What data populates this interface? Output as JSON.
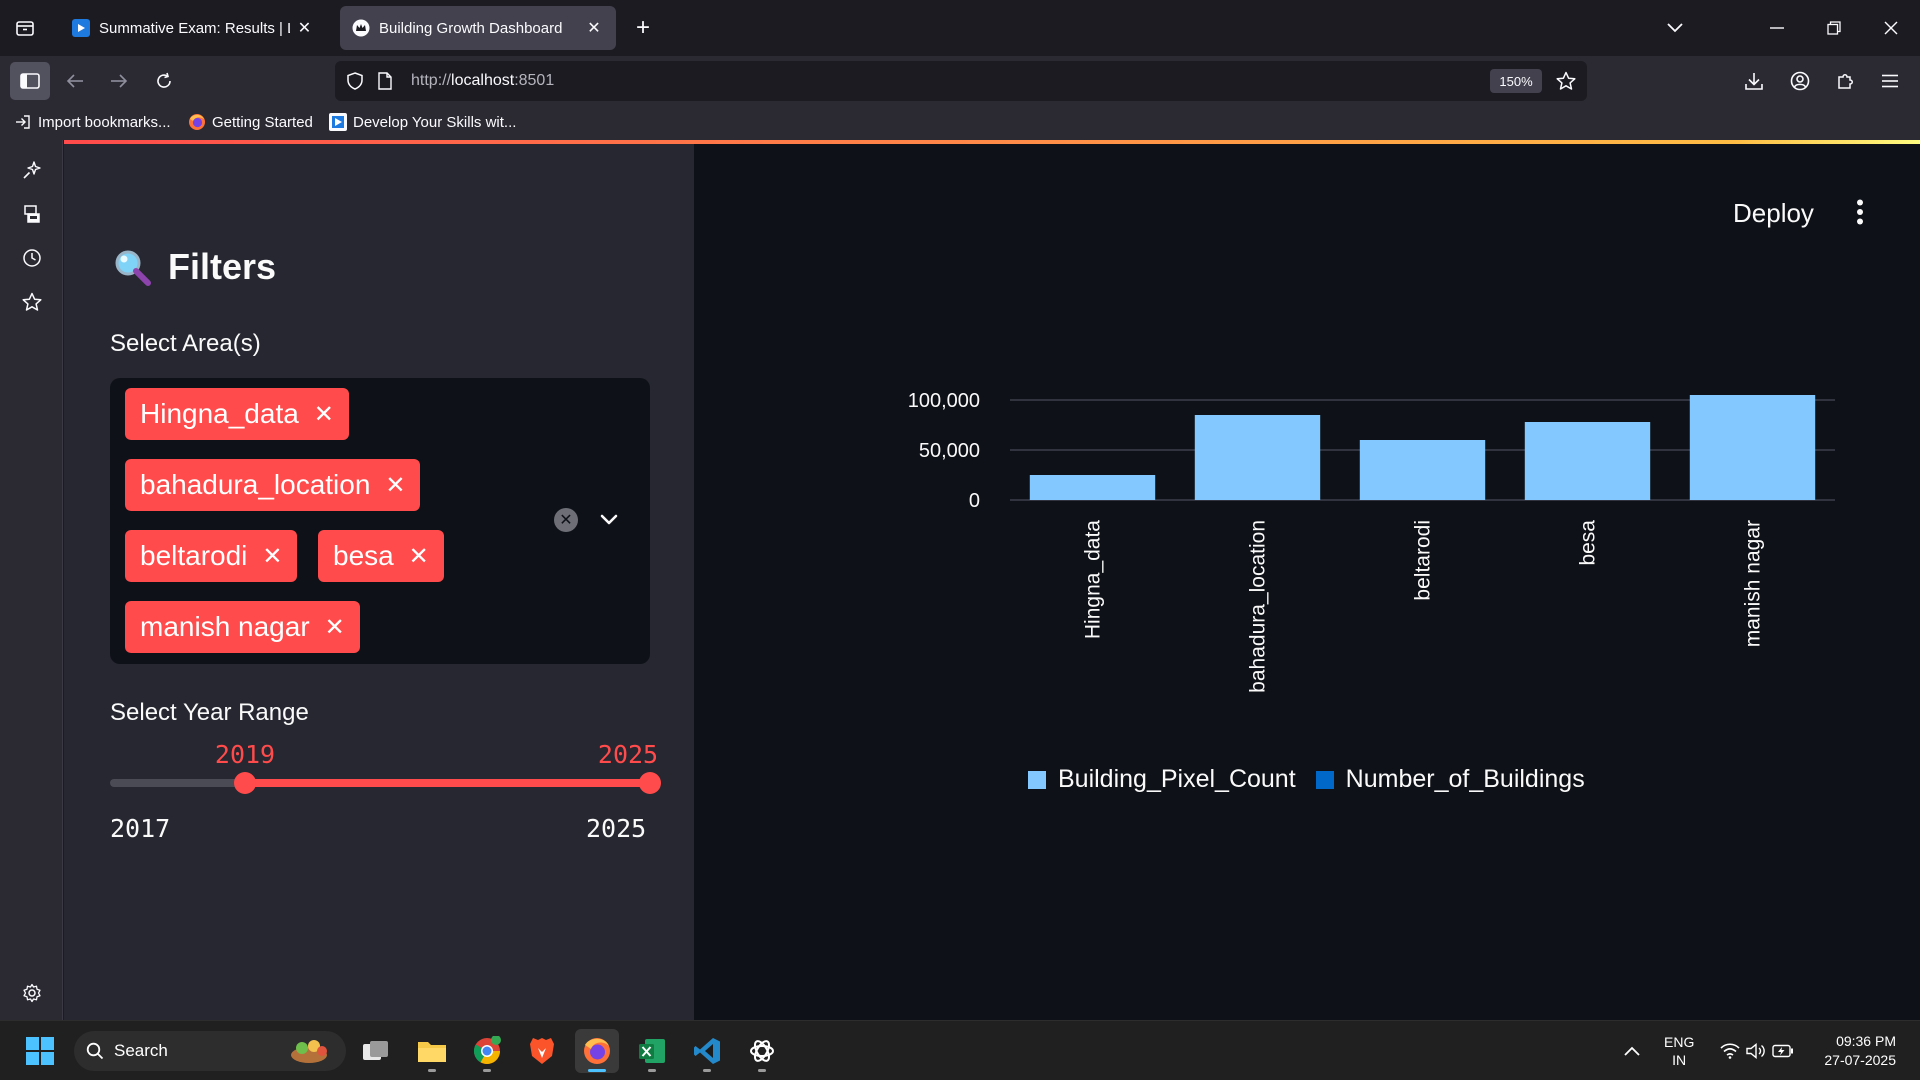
{
  "browser": {
    "tabs": [
      {
        "title": "Summative Exam: Results | Linke",
        "active": false
      },
      {
        "title": "Building Growth Dashboard",
        "active": true
      }
    ],
    "url": {
      "scheme": "http://",
      "host": "localhost",
      "port": ":8501"
    },
    "zoom": "150%",
    "bookmarks": [
      "Import bookmarks...",
      "Getting Started",
      "Develop Your Skills wit..."
    ]
  },
  "sidebar": {
    "title": "Filters",
    "area_label": "Select Area(s)",
    "areas": [
      "Hingna_data",
      "bahadura_location",
      "beltarodi",
      "besa",
      "manish nagar"
    ],
    "year_label": "Select Year Range",
    "year_min": 2017,
    "year_max": 2025,
    "year_selected": [
      2019,
      2025
    ],
    "year_min_label": "2017",
    "year_max_label": "2025",
    "year_low_label": "2019",
    "year_high_label": "2025"
  },
  "header": {
    "deploy_label": "Deploy"
  },
  "colors": {
    "accent": "#ff4b4b",
    "series_pixel": "#83c9ff",
    "series_buildings": "#0068c9",
    "app_bg": "#0e1117",
    "sidebar_bg": "#262730"
  },
  "chart_data": {
    "type": "bar",
    "categories": [
      "Hingna_data",
      "bahadura_location",
      "beltarodi",
      "besa",
      "manish nagar"
    ],
    "series": [
      {
        "name": "Building_Pixel_Count",
        "values": [
          25000,
          85000,
          60000,
          78000,
          105000
        ]
      },
      {
        "name": "Number_of_Buildings",
        "values": [
          0,
          0,
          0,
          0,
          0
        ]
      }
    ],
    "y_ticks": [
      0,
      50000,
      100000
    ],
    "y_tick_labels": [
      "0",
      "50,000",
      "100,000"
    ],
    "ylim": [
      0,
      100000
    ],
    "legend_position": "bottom",
    "grid": true
  },
  "taskbar": {
    "search_label": "Search",
    "lang": "ENG",
    "region": "IN",
    "time": "09:36 PM",
    "date": "27-07-2025"
  }
}
